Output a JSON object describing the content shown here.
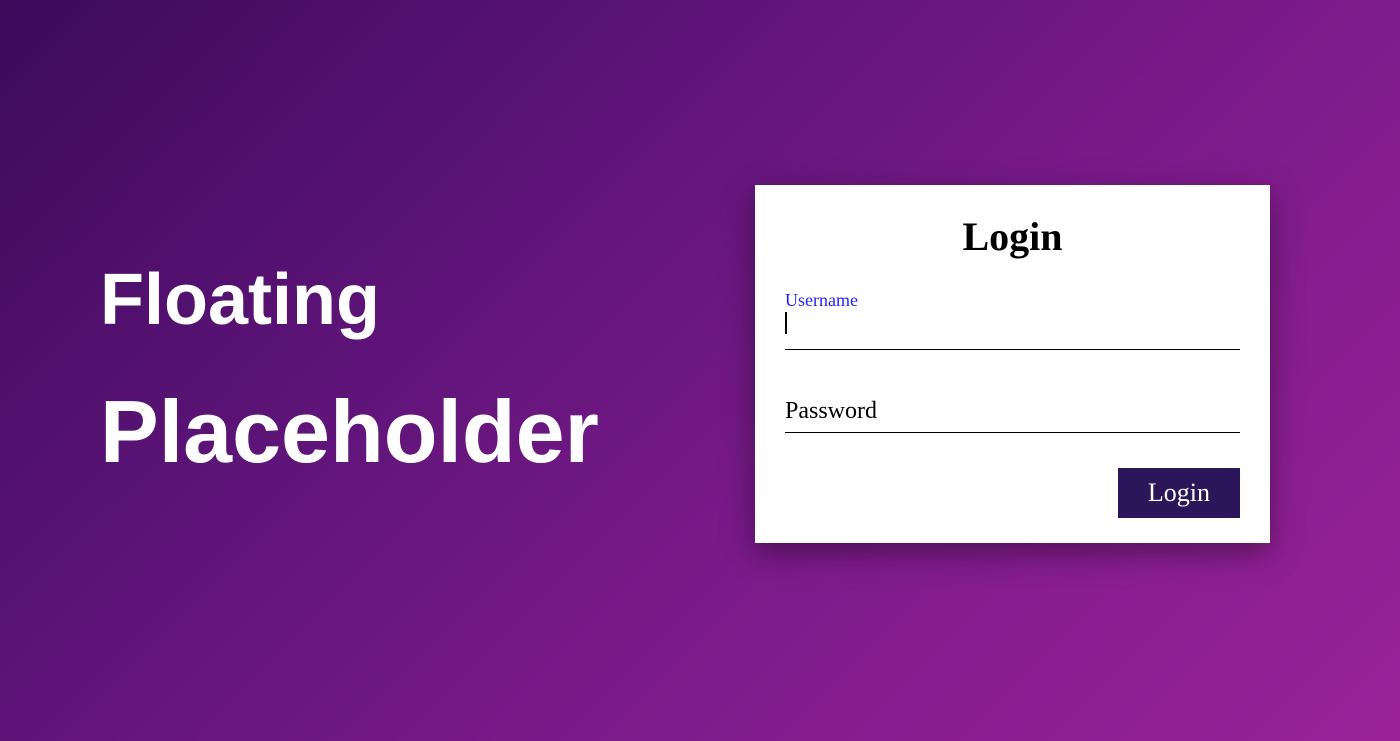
{
  "headline": {
    "line1": "Floating",
    "line2": "Placeholder"
  },
  "card": {
    "title": "Login",
    "username_label": "Username",
    "username_value": "",
    "password_placeholder": "Password",
    "password_value": "",
    "submit_label": "Login"
  }
}
